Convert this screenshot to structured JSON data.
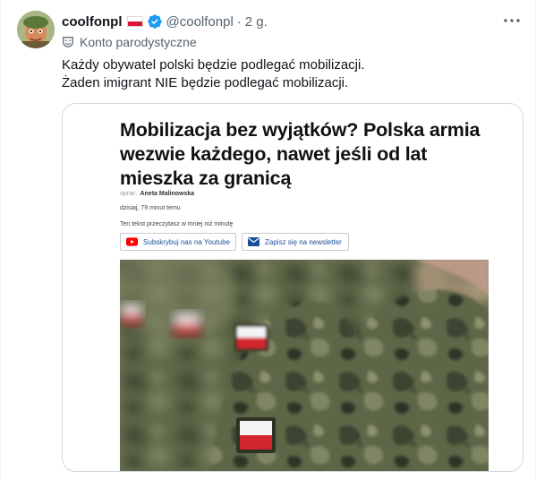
{
  "tweet": {
    "display_name": "coolfonpl",
    "handle": "@coolfonpl",
    "separator": "·",
    "time": "2 g.",
    "parody_label": "Konto parodystyczne",
    "text_lines": [
      "Każdy obywatel polski będzie podlegać mobilizacji.",
      "Żaden imigrant NIE będzie podlegać mobilizacji."
    ],
    "colors": {
      "text": "#0f1419",
      "secondary": "#536471",
      "verified": "#1d9bf0"
    }
  },
  "card": {
    "title": "Mobilizacja bez wyjątków? Polska armia wezwie każdego, nawet jeśli od lat mieszka za granicą",
    "byline_prefix": "oprac.",
    "author": "Aneta Malinowska",
    "date": "dzisiaj, 79 minut temu",
    "read_time": "Ten tekst przeczytasz w mniej niż minutę",
    "youtube_button": "Subskrybuj nas na Youtube",
    "newsletter_button": "Zapisz się na newsletter",
    "photo_icon": "soldiers-camouflage-photo"
  }
}
